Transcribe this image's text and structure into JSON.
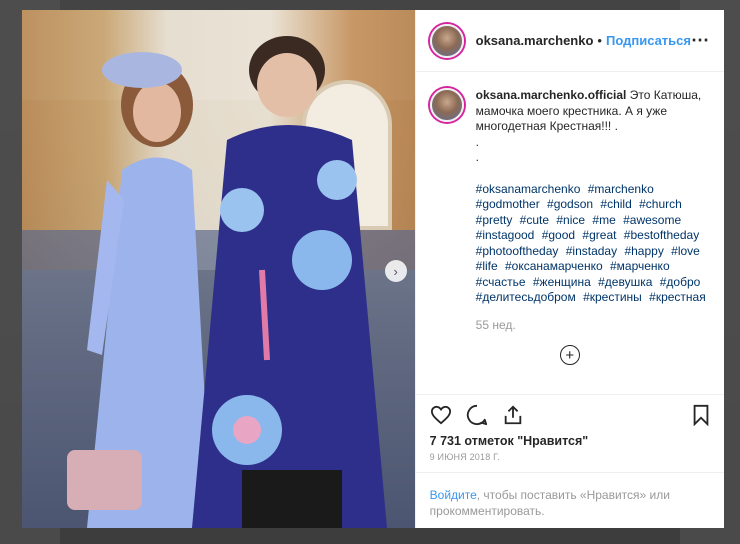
{
  "post": {
    "author": "oksana.marchenko",
    "follow_label": "Подписаться",
    "caption_author": "oksana.marchenko.official",
    "caption_text": "Это Катюша, мамочка моего крестника. А я уже многодетная Крестная!!! .",
    "caption_dots": [
      ".",
      "."
    ],
    "hashtags": [
      "#oksanamarchenko",
      "#marchenko",
      "#godmother",
      "#godson",
      "#child",
      "#church",
      "#pretty",
      "#cute",
      "#nice",
      "#me",
      "#awesome",
      "#instagood",
      "#good",
      "#great",
      "#bestoftheday",
      "#photooftheday",
      "#instaday",
      "#happy",
      "#love",
      "#life",
      "#оксанамарченко",
      "#марченко",
      "#счастье",
      "#женщина",
      "#девушка",
      "#добро",
      "#делитесьдобром",
      "#крестины",
      "#крестная"
    ],
    "age": "55 нед.",
    "likes": "7 731 отметок \"Нравится\"",
    "date": "9 июня 2018 г.",
    "login_link": "Войдите",
    "login_text": ", чтобы поставить «Нравится» или прокомментировать."
  },
  "icons": {
    "more": "more-icon",
    "next": "chevron-right-icon",
    "like": "heart-icon",
    "comment": "comment-icon",
    "share": "share-icon",
    "save": "bookmark-icon",
    "load_more": "plus-circle-icon"
  },
  "colors": {
    "link": "#3897f0",
    "hashtag": "#003569",
    "text": "#262626",
    "muted": "#999999"
  }
}
